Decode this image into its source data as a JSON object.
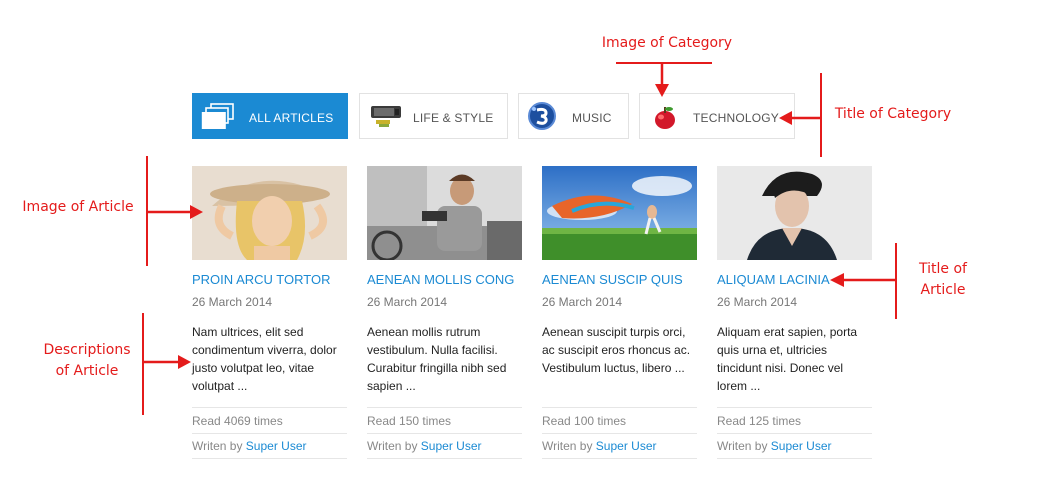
{
  "categories": [
    {
      "label": "ALL ARTICLES",
      "icon": "stacked-pages-icon",
      "active": true
    },
    {
      "label": "LIFE & STYLE",
      "icon": "tablet-device-icon",
      "active": false
    },
    {
      "label": "MUSIC",
      "icon": "music-badge-icon",
      "active": false
    },
    {
      "label": "TECHNOLOGY",
      "icon": "apple-icon",
      "active": false
    }
  ],
  "articles": [
    {
      "title": "PROIN ARCU TORTOR",
      "date": "26 March 2014",
      "description": "Nam ultrices, elit sed condimentum viverra, dolor justo volutpat leo, vitae volutpat ...",
      "read": "Read 4069 times",
      "writen_by": "Writen by ",
      "author": "Super User",
      "image": "woman-in-hat-photo"
    },
    {
      "title": "AENEAN MOLLIS CONG",
      "date": "26 March 2014",
      "description": "Aenean mollis rutrum vestibulum. Nulla facilisi. Curabitur fringilla nibh sed sapien ...",
      "read": "Read 150 times",
      "writen_by": "Writen by ",
      "author": "Super User",
      "image": "man-with-phone-photo"
    },
    {
      "title": "AENEAN SUSCIP QUIS",
      "date": "26 March 2014",
      "description": "Aenean suscipit turpis orci, ac suscipit eros rhoncus ac. Vestibulum luctus, libero ...",
      "read": "Read 100 times",
      "writen_by": "Writen by ",
      "author": "Super User",
      "image": "person-with-scarf-in-field-photo"
    },
    {
      "title": "ALIQUAM LACINIA",
      "date": "26 March 2014",
      "description": "Aliquam erat sapien, porta quis urna et, ultricies tincidunt nisi. Donec vel lorem ...",
      "read": "Read 125 times",
      "writen_by": "Writen by ",
      "author": "Super User",
      "image": "man-portrait-photo"
    }
  ],
  "annotations": {
    "image_of_category": "Image of Category",
    "title_of_category": "Title of Category",
    "image_of_article": "Image of Article",
    "title_of_article": "Title of\nArticle",
    "descriptions_of_article": "Descriptions\nof Article"
  },
  "colors": {
    "accent": "#1b8ad3",
    "annotation": "#e41b1b"
  }
}
